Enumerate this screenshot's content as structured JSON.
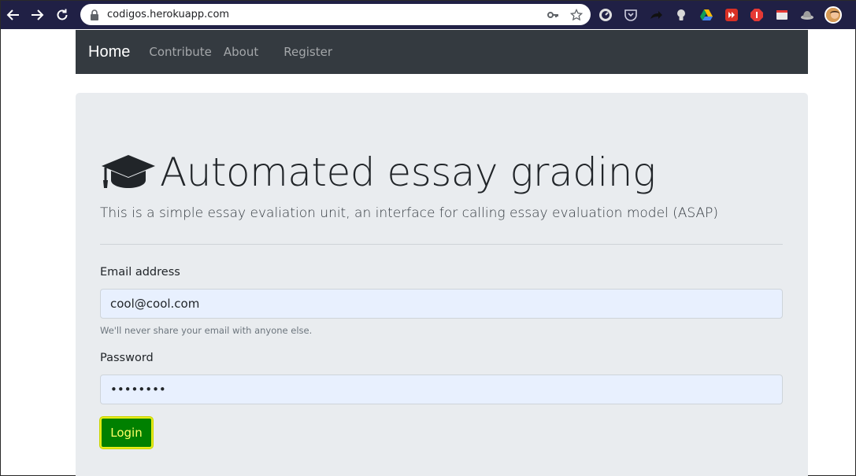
{
  "browser": {
    "url": "codigos.herokuapp.com"
  },
  "navbar": {
    "brand": "Home",
    "links": [
      "Contribute",
      "About",
      "Register"
    ]
  },
  "hero": {
    "icon": "graduation-cap-icon",
    "title": "Automated essay grading",
    "lead": "This is a simple essay evaliation unit, an interface for calling essay evaluation model (ASAP)"
  },
  "form": {
    "email_label": "Email address",
    "email_value": "cool@cool.com",
    "email_help": "We'll never share your email with anyone else.",
    "password_label": "Password",
    "password_value": "••••••••",
    "submit_label": "Login"
  },
  "colors": {
    "browser_bar": "#202045",
    "navbar": "#343a40",
    "jumbotron": "#e9ecef",
    "button": "#008000",
    "button_text": "#ffff66"
  }
}
